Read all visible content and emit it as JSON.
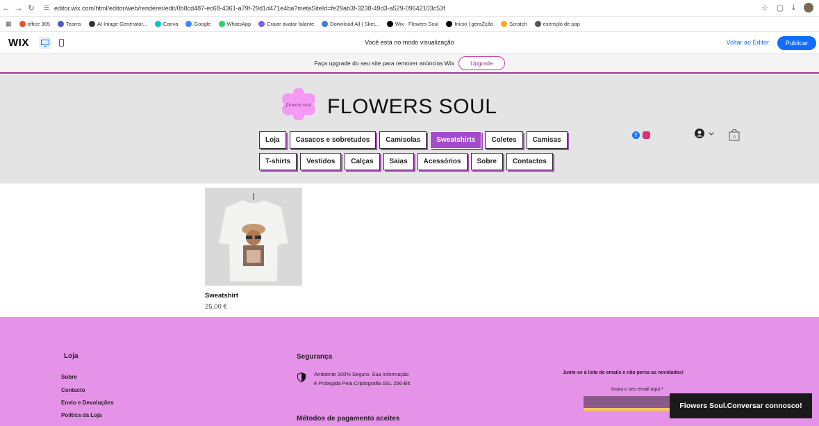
{
  "browser": {
    "url": "editor.wix.com/html/editor/web/renderer/edit/0b8cd487-ec68-4361-a79f-29d1d471e4ba?metaSiteId=fe29ab3f-3238-49d3-a529-09642103c53f",
    "bookmarks": [
      {
        "label": "office 365",
        "color": "#e8502a"
      },
      {
        "label": "Teams",
        "color": "#5059c9"
      },
      {
        "label": "AI Image Generator...",
        "color": "#333333"
      },
      {
        "label": "Canva",
        "color": "#00c4cc"
      },
      {
        "label": "Google",
        "color": "#4285f4"
      },
      {
        "label": "WhatsApp",
        "color": "#25d366"
      },
      {
        "label": "Craiar avatar falante",
        "color": "#7b5cf5"
      },
      {
        "label": "Download All | Sket...",
        "color": "#3b7dd8"
      },
      {
        "label": "Wix - Flowers Soul",
        "color": "#000000"
      },
      {
        "label": "Início | geraZção",
        "color": "#000000"
      },
      {
        "label": "Scratch",
        "color": "#f9a825"
      },
      {
        "label": "exemplo de pap",
        "color": "#555555"
      }
    ]
  },
  "wix_bar": {
    "logo": "WIX",
    "mode_text": "Você está no modo visualização",
    "back_label": "Voltar ao Editor",
    "publish_label": "Publicar"
  },
  "upgrade": {
    "text": "Faça upgrade do seu site para remover anúncios Wix",
    "button": "Upgrade"
  },
  "site": {
    "title": "FLOWERS SOUL",
    "logo_text": "flowers soul",
    "menu_row1": [
      "Loja",
      "Casacos e sobretudos",
      "Camisolas",
      "Sweatshirts",
      "Coletes",
      "Camisas"
    ],
    "menu_row2": [
      "T-shirts",
      "Vestidos",
      "Calças",
      "Saias",
      "Acessórios",
      "Sobre",
      "Contactos"
    ],
    "active_menu": "Sweatshirts",
    "cart_count": "0"
  },
  "product": {
    "name": "Sweatshirt",
    "price": "25,00 €"
  },
  "footer": {
    "col1_heading": "Loja",
    "col1_links": [
      "Sobre",
      "Contacto",
      "Envio e Devoluções",
      "Política da Loja"
    ],
    "col2_heading": "Segurança",
    "security_line1": "Ambiente 100% Seguro. Sua Informação",
    "security_line2": "é Protegida Pela Criptografia SSL 256-Bit.",
    "payments_heading": "Métodos de pagamento aceites",
    "newsletter_title": "Junte-se à lista de emails e não perca as novidades!",
    "email_label": "Insira o seu email aqui *"
  },
  "chat": {
    "label": "Flowers Soul.Conversar connosco!"
  },
  "colors": {
    "accent": "#a44bcb",
    "footer_bg": "#e593e8",
    "header_bg": "#e5e4e4",
    "wix_blue": "#116dff"
  }
}
